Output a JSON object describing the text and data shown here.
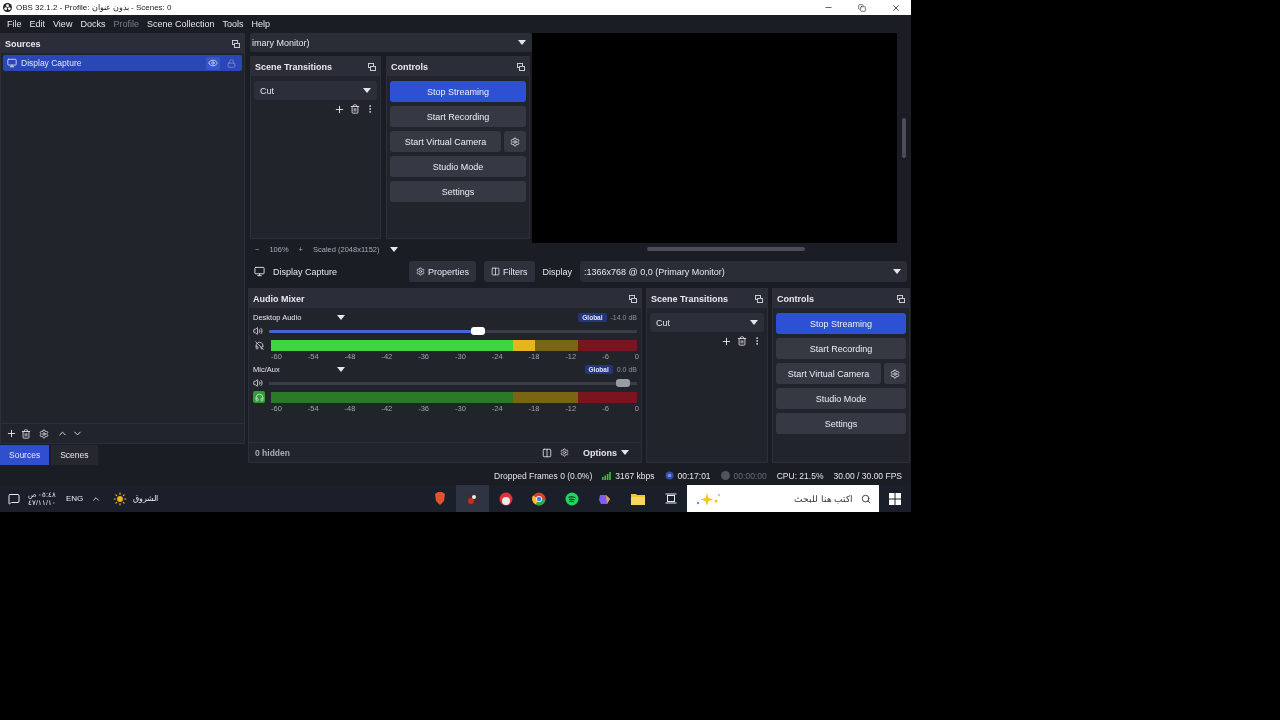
{
  "window": {
    "title": "OBS 32.1.2 - Profile: بدون عنوان - Scenes: 0"
  },
  "menu": [
    {
      "label": "File",
      "disabled": false
    },
    {
      "label": "Edit",
      "disabled": false
    },
    {
      "label": "View",
      "disabled": false
    },
    {
      "label": "Docks",
      "disabled": false
    },
    {
      "label": "Profile",
      "disabled": true
    },
    {
      "label": "Scene Collection",
      "disabled": false
    },
    {
      "label": "Tools",
      "disabled": false
    },
    {
      "label": "Help",
      "disabled": false
    }
  ],
  "sources_dock": {
    "title": "Sources",
    "items": [
      {
        "name": "Display Capture",
        "visible": true,
        "locked": false,
        "selected": true
      }
    ]
  },
  "dock_tabs": [
    {
      "label": "Sources",
      "selected": true
    },
    {
      "label": "Scenes",
      "selected": false
    }
  ],
  "top_combo": {
    "value": "imary Monitor)"
  },
  "upper_transitions": {
    "title": "Scene Transitions",
    "value": "Cut"
  },
  "upper_controls": {
    "title": "Controls",
    "buttons": [
      {
        "label": "Stop Streaming",
        "active": true,
        "kind": "plain"
      },
      {
        "label": "Start Recording",
        "active": false,
        "kind": "plain"
      },
      {
        "label": "Start Virtual Camera",
        "active": false,
        "kind": "with_settings"
      },
      {
        "label": "Studio Mode",
        "active": false,
        "kind": "plain"
      },
      {
        "label": "Settings",
        "active": false,
        "kind": "plain"
      }
    ]
  },
  "zoom_bar": {
    "minus": "−",
    "zoom": "106%",
    "plus": "+",
    "scale": "Scaled (2048x1152)"
  },
  "source_toolbar": {
    "source": "Display Capture",
    "properties": "Properties",
    "filters": "Filters",
    "display_label": "Display",
    "display_value": ":1366x768 @ 0,0 (Primary Monitor)"
  },
  "audio_mixer": {
    "title": "Audio Mixer",
    "channels": [
      {
        "name": "Desktop Audio",
        "scope": "Global",
        "reading": "-14.0 dB",
        "selected": true,
        "monitoring": false,
        "volume": {
          "level": 0.57
        },
        "meter": {
          "level": 0.72
        },
        "ticks": [
          "-60",
          "-54",
          "-48",
          "-42",
          "-36",
          "-30",
          "-24",
          "-18",
          "-12",
          "-6",
          "0"
        ]
      },
      {
        "name": "Mic/Aux",
        "scope": "Global",
        "reading": "0.0 dB",
        "selected": false,
        "monitoring": true,
        "volume": {
          "level": 0.98
        },
        "meter": {
          "level": 0
        },
        "ticks": [
          "-60",
          "-54",
          "-48",
          "-42",
          "-36",
          "-30",
          "-24",
          "-18",
          "-12",
          "-6",
          "0"
        ]
      }
    ],
    "hidden": "0 hidden",
    "options": "Options"
  },
  "lower_transitions": {
    "title": "Scene Transitions",
    "value": "Cut"
  },
  "lower_controls": {
    "title": "Controls",
    "buttons": [
      {
        "label": "Stop Streaming",
        "active": true,
        "kind": "plain"
      },
      {
        "label": "Start Recording",
        "active": false,
        "kind": "plain"
      },
      {
        "label": "Start Virtual Camera",
        "active": false,
        "kind": "with_settings"
      },
      {
        "label": "Studio Mode",
        "active": false,
        "kind": "plain"
      },
      {
        "label": "Settings",
        "active": false,
        "kind": "plain"
      }
    ]
  },
  "status_bar": {
    "dropped": "Dropped Frames 0 (0.0%)",
    "bitrate": "3167 kbps",
    "stream_time": "00:17:01",
    "record_time": "00:00:00",
    "cpu": "CPU: 21.5%",
    "fps": "30.00 / 30.00 FPS"
  },
  "taskbar": {
    "time": "٠٥:٤٨ ص",
    "date": "٤٧/١١/١٠",
    "language": "ENG",
    "weather": "الشروق",
    "search_placeholder": "اكتب هنا للبحث"
  }
}
